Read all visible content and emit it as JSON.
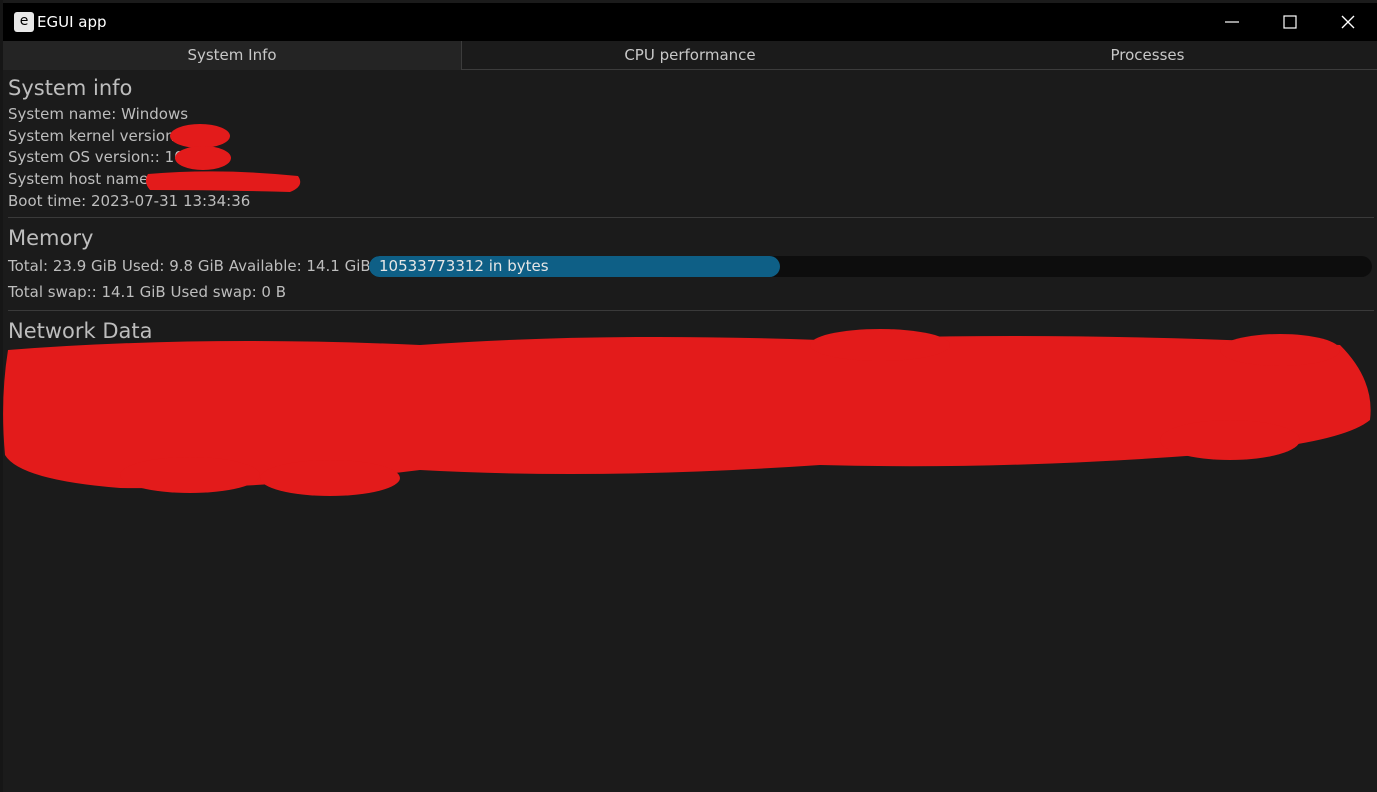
{
  "window": {
    "app_icon_letter": "e",
    "title": "EGUI app"
  },
  "tabs": [
    {
      "label": "System Info",
      "active": true
    },
    {
      "label": "CPU performance",
      "active": false
    },
    {
      "label": "Processes",
      "active": false
    }
  ],
  "system_info": {
    "heading": "System info",
    "system_name": "System name: Windows",
    "kernel_version": "System kernel version:",
    "os_version": "System OS version:: 10",
    "host_name": "System host name:",
    "boot_time": "Boot time: 2023-07-31 13:34:36"
  },
  "memory": {
    "heading": "Memory",
    "summary": "Total: 23.9 GiB  Used: 9.8 GiB  Available: 14.1 GiB",
    "progress_label": "10533773312 in bytes",
    "used_fraction": 0.41,
    "swap": "Total swap:: 14.1 GiB  Used swap: 0 B"
  },
  "network": {
    "heading": "Network Data"
  },
  "colors": {
    "progress_fill": "#0e5f86",
    "redaction": "#e31b1b"
  }
}
